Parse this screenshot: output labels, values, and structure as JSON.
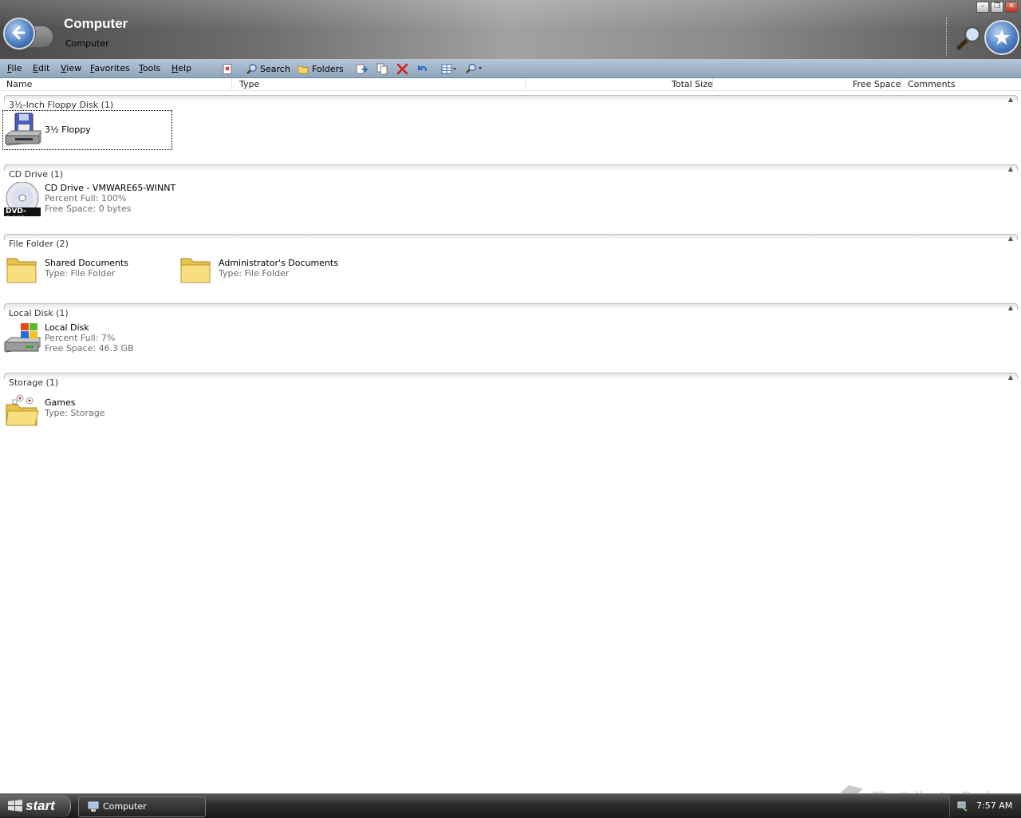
{
  "window": {
    "title": "Computer",
    "subtitle": "Computer"
  },
  "menu": [
    "File",
    "Edit",
    "View",
    "Favorites",
    "Tools",
    "Help"
  ],
  "toolbar": {
    "search_label": "Search",
    "folders_label": "Folders"
  },
  "columns": [
    "Name",
    "Type",
    "Total Size",
    "Free Space",
    "Comments"
  ],
  "groups": [
    {
      "title": "3½-Inch Floppy Disk (1)",
      "items": [
        {
          "name": "3½ Floppy",
          "icon": "floppy-drive-icon"
        }
      ]
    },
    {
      "title": "CD Drive (1)",
      "items": [
        {
          "name": "CD Drive - VMWARE65-WINNT",
          "line2": "Percent Full: 100%",
          "line3": "Free Space: 0 bytes",
          "icon": "dvd-rom-icon",
          "badge": "DVD-ROM"
        }
      ]
    },
    {
      "title": "File Folder (2)",
      "items": [
        {
          "name": "Shared Documents",
          "line2": "Type: File Folder",
          "icon": "folder-icon"
        },
        {
          "name": "Administrator's Documents",
          "line2": "Type: File Folder",
          "icon": "folder-icon"
        }
      ]
    },
    {
      "title": "Local Disk (1)",
      "items": [
        {
          "name": "Local Disk",
          "line2": "Percent Full: 7%",
          "line3": "Free Space: 46.3 GB",
          "icon": "local-disk-icon"
        }
      ]
    },
    {
      "title": "Storage (1)",
      "items": [
        {
          "name": "Games",
          "line2": "Type: Storage",
          "icon": "games-folder-icon"
        }
      ]
    }
  ],
  "taskbar": {
    "start_label": "start",
    "task_label": "Computer",
    "clock": "7:57 AM"
  },
  "watermark": "The Collection Book",
  "colors": {
    "menubar": "#9fb4c9",
    "taskbar": "#2b2b2b",
    "accent_blue": "#4d7fc2"
  }
}
